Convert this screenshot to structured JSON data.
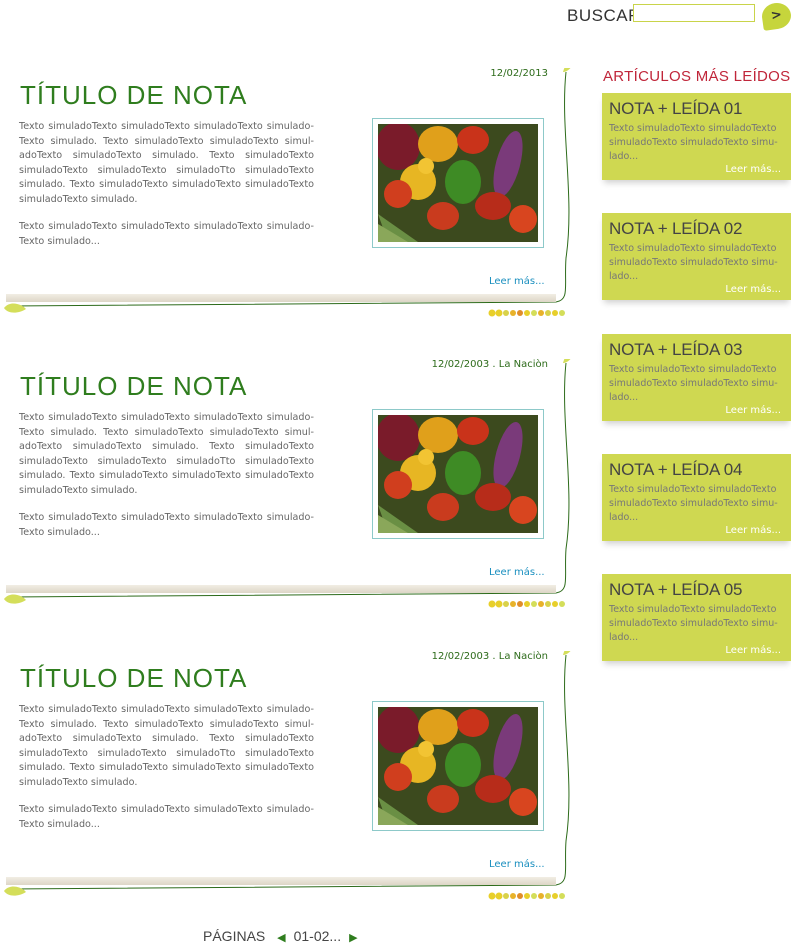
{
  "search": {
    "label": "BUSCAR",
    "value": "",
    "button_label": ">"
  },
  "articles": [
    {
      "date": "12/02/2013",
      "title": "TÍTULO DE NOTA",
      "paragraph1": "Texto simuladoTexto simuladoTexto simuladoTexto simulado-Texto simulado. Texto simuladoTexto simuladoTexto simul-adoTexto simuladoTexto simulado. Texto simuladoTexto simuladoTexto simuladoTexto simuladoTto simuladoTexto simulado. Texto simuladoTexto simuladoTexto simuladoTexto simuladoTexto simulado.",
      "paragraph2": "Texto simuladoTexto simuladoTexto simuladoTexto simulado-Texto simulado...",
      "read_more": "Leer más..."
    },
    {
      "date": "12/02/2003 . La Naciòn",
      "title": "TÍTULO DE NOTA",
      "paragraph1": "Texto simuladoTexto simuladoTexto simuladoTexto simulado-Texto simulado. Texto simuladoTexto simuladoTexto simul-adoTexto simuladoTexto simulado. Texto simuladoTexto simuladoTexto simuladoTexto simuladoTto simuladoTexto simulado. Texto simuladoTexto simuladoTexto simuladoTexto simuladoTexto simulado.",
      "paragraph2": "Texto simuladoTexto simuladoTexto simuladoTexto simulado-Texto simulado...",
      "read_more": "Leer más..."
    },
    {
      "date": "12/02/2003 . La Naciòn",
      "title": "TÍTULO DE NOTA",
      "paragraph1": "Texto simuladoTexto simuladoTexto simuladoTexto simulado-Texto simulado. Texto simuladoTexto simuladoTexto simul-adoTexto simuladoTexto simulado. Texto simuladoTexto simuladoTexto simuladoTexto simuladoTto simuladoTexto simulado. Texto simuladoTexto simuladoTexto simuladoTexto simuladoTexto simulado.",
      "paragraph2": "Texto simuladoTexto simuladoTexto simuladoTexto simulado-Texto simulado...",
      "read_more": "Leer más..."
    }
  ],
  "sidebar": {
    "heading": "ARTÍCULOS MÁS LEÍDOS",
    "items": [
      {
        "title": "NOTA + LEÍDA 01",
        "text": "Texto simuladoTexto simuladoTexto simuladoTexto simuladoTexto simu-lado...",
        "read_more": "Leer más..."
      },
      {
        "title": "NOTA + LEÍDA 02",
        "text": "Texto simuladoTexto simuladoTexto simuladoTexto simuladoTexto simu-lado...",
        "read_more": "Leer más..."
      },
      {
        "title": "NOTA + LEÍDA 03",
        "text": "Texto simuladoTexto simuladoTexto simuladoTexto simuladoTexto simu-lado...",
        "read_more": "Leer más..."
      },
      {
        "title": "NOTA + LEÍDA 04",
        "text": "Texto simuladoTexto simuladoTexto simuladoTexto simuladoTexto simu-lado...",
        "read_more": "Leer más..."
      },
      {
        "title": "NOTA + LEÍDA 05",
        "text": "Texto simuladoTexto simuladoTexto simuladoTexto simuladoTexto simu-lado...",
        "read_more": "Leer más..."
      }
    ]
  },
  "pagination": {
    "label": "PÁGINAS",
    "range": "01-02..."
  },
  "colors": {
    "accent_green": "#2f7d1e",
    "leaf_green": "#c6d53c",
    "sidebar_bg": "#cfd851",
    "heading_red": "#c0263a",
    "link_blue": "#1a8fbf"
  },
  "icons": {
    "leaf": "leaf-icon",
    "photo": "vegetables-photo",
    "prev": "arrow-left-icon",
    "next": "arrow-right-icon"
  }
}
